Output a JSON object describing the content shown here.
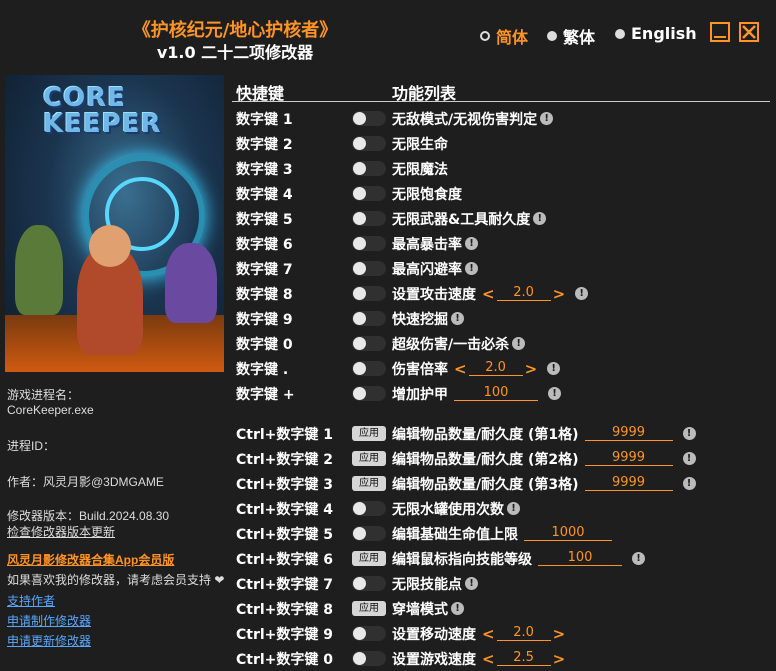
{
  "header": {
    "title": "《护核纪元/地心护核者》",
    "subtitle": "v1.0 二十二项修改器"
  },
  "languages": [
    {
      "label": "简体",
      "selected": true
    },
    {
      "label": "繁体",
      "selected": false
    },
    {
      "label": "English",
      "selected": false
    }
  ],
  "window_buttons": {
    "minimize": "minimize-icon",
    "close": "close-icon"
  },
  "cover": {
    "logo_line1": "CORE",
    "logo_line2": "KEEPER"
  },
  "info": {
    "process_label": "游戏进程名：",
    "process_value": "CoreKeeper.exe",
    "pid_label": "进程ID：",
    "author": "作者：风灵月影@3DMGAME",
    "version": "修改器版本：Build.2024.08.30",
    "check_update": "检查修改器版本更新",
    "vip": "风灵月影修改器合集App会员版",
    "support_text": "如果喜欢我的修改器，请考虑会员支持 ❤",
    "links": [
      "支持作者",
      "申请制作修改器",
      "申请更新修改器"
    ]
  },
  "table": {
    "col_key": "快捷键",
    "col_func": "功能列表",
    "rows": [
      {
        "key": "数字键 1",
        "control": "toggle",
        "label": "无敌模式/无视伤害判定",
        "info": true
      },
      {
        "key": "数字键 2",
        "control": "toggle",
        "label": "无限生命",
        "info": false
      },
      {
        "key": "数字键 3",
        "control": "toggle",
        "label": "无限魔法",
        "info": false
      },
      {
        "key": "数字键 4",
        "control": "toggle",
        "label": "无限饱食度",
        "info": false
      },
      {
        "key": "数字键 5",
        "control": "toggle",
        "label": "无限武器&工具耐久度",
        "info": true
      },
      {
        "key": "数字键 6",
        "control": "toggle",
        "label": "最高暴击率",
        "info": true
      },
      {
        "key": "数字键 7",
        "control": "toggle",
        "label": "最高闪避率",
        "info": true
      },
      {
        "key": "数字键 8",
        "control": "toggle",
        "label": "设置攻击速度",
        "stepper": "2.0",
        "info": true
      },
      {
        "key": "数字键 9",
        "control": "toggle",
        "label": "快速挖掘",
        "info": true
      },
      {
        "key": "数字键 0",
        "control": "toggle",
        "label": "超级伤害/一击必杀",
        "info": true
      },
      {
        "key": "数字键 .",
        "control": "toggle",
        "label": "伤害倍率",
        "stepper": "2.0",
        "info": true
      },
      {
        "key": "数字键 +",
        "control": "toggle",
        "label": "增加护甲",
        "field": "100",
        "info": true
      },
      {
        "key": "Ctrl+数字键 1",
        "control": "apply",
        "label": "编辑物品数量/耐久度 (第1格)",
        "field": "9999",
        "info": true
      },
      {
        "key": "Ctrl+数字键 2",
        "control": "apply",
        "label": "编辑物品数量/耐久度 (第2格)",
        "field": "9999",
        "info": true
      },
      {
        "key": "Ctrl+数字键 3",
        "control": "apply",
        "label": "编辑物品数量/耐久度 (第3格)",
        "field": "9999",
        "info": true
      },
      {
        "key": "Ctrl+数字键 4",
        "control": "toggle",
        "label": "无限水罐使用次数",
        "info": true
      },
      {
        "key": "Ctrl+数字键 5",
        "control": "toggle",
        "label": "编辑基础生命值上限",
        "field": "1000",
        "info": false
      },
      {
        "key": "Ctrl+数字键 6",
        "control": "apply",
        "label": "编辑鼠标指向技能等级",
        "field": "100",
        "info": true
      },
      {
        "key": "Ctrl+数字键 7",
        "control": "toggle",
        "label": "无限技能点",
        "info": true
      },
      {
        "key": "Ctrl+数字键 8",
        "control": "apply",
        "label": "穿墙模式",
        "info": true
      },
      {
        "key": "Ctrl+数字键 9",
        "control": "toggle",
        "label": "设置移动速度",
        "stepper": "2.0",
        "info": false
      },
      {
        "key": "Ctrl+数字键 0",
        "control": "toggle",
        "label": "设置游戏速度",
        "stepper": "2.5",
        "info": false
      }
    ],
    "apply_label": "应用",
    "info_glyph": "!",
    "stepper_left": "<",
    "stepper_right": ">"
  },
  "colors": {
    "accent": "#ff9326",
    "background": "#1e1e1e",
    "link": "#5aa7ff"
  }
}
